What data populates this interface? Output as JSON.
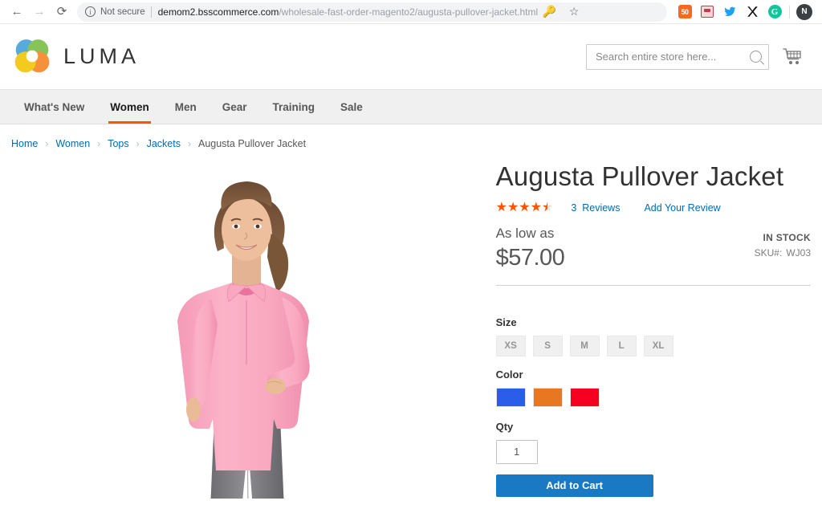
{
  "browser": {
    "back_icon": "back-arrow-icon",
    "forward_icon": "forward-arrow-icon",
    "reload_icon": "reload-icon",
    "security_label": "Not secure",
    "url_host": "demom2.bsscommerce.com",
    "url_path": "/wholesale-fast-order-magento2/augusta-pullover-jacket.html",
    "url_full": "demom2.bsscommerce.com/wholesale-fast-order-magento2/augusta-pullover-jacket.html",
    "key_icon": "key-icon",
    "bookmark_icon": "star-outline-icon",
    "extensions": [
      {
        "name": "badge-50-extension-icon",
        "label": "50"
      },
      {
        "name": "inbox-extension-icon",
        "label": ""
      },
      {
        "name": "twitter-extension-icon",
        "label": ""
      },
      {
        "name": "x-extension-icon",
        "label": "X"
      },
      {
        "name": "grammarly-extension-icon",
        "label": "G"
      }
    ],
    "profile_initial": "N"
  },
  "header": {
    "logo_text": "LUMA",
    "logo_colors": [
      "#4fa1d8",
      "#76bc43",
      "#f58220",
      "#f2c300"
    ],
    "search_placeholder": "Search entire store here...",
    "search_value": "",
    "cart_icon": "shopping-cart-icon"
  },
  "nav": {
    "items": [
      {
        "label": "What's New",
        "active": false
      },
      {
        "label": "Women",
        "active": true
      },
      {
        "label": "Men",
        "active": false
      },
      {
        "label": "Gear",
        "active": false
      },
      {
        "label": "Training",
        "active": false
      },
      {
        "label": "Sale",
        "active": false
      }
    ],
    "active_underline_color": "#ff5501"
  },
  "breadcrumb": {
    "items": [
      "Home",
      "Women",
      "Tops",
      "Jackets",
      "Augusta Pullover Jacket"
    ],
    "separator": "›"
  },
  "product": {
    "title": "Augusta Pullover Jacket",
    "rating_stars": 4.5,
    "rating_percent": 90,
    "review_count": "3",
    "reviews_label": "Reviews",
    "add_review_label": "Add Your Review",
    "as_low_as_label": "As low as",
    "price": "$57.00",
    "stock_status": "IN STOCK",
    "sku_label": "SKU#:",
    "sku_value": "WJ03",
    "size_label": "Size",
    "sizes": [
      "XS",
      "S",
      "M",
      "L",
      "XL"
    ],
    "color_label": "Color",
    "colors": [
      {
        "name": "blue",
        "hex": "#2a5ee8"
      },
      {
        "name": "orange",
        "hex": "#e87722"
      },
      {
        "name": "red",
        "hex": "#f50021"
      }
    ],
    "qty_label": "Qty",
    "qty_value": "1",
    "add_to_cart_label": "Add to Cart",
    "image_alt": "Woman wearing pink Augusta pullover jacket with grey leggings"
  },
  "colors": {
    "link": "#006bb4",
    "accent": "#ff5501",
    "button": "#1979c3",
    "text": "#575757"
  }
}
